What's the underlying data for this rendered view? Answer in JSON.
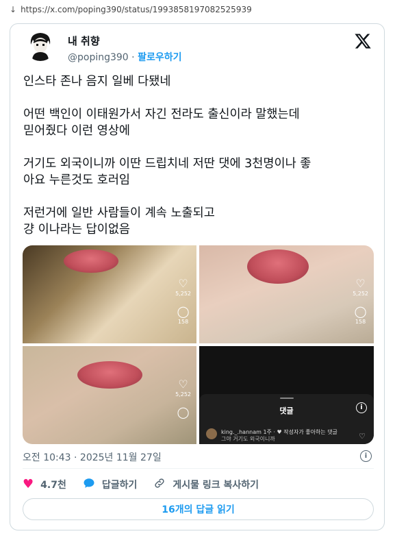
{
  "url": "https://x.com/poping390/status/1993858197082525939",
  "tweet": {
    "display_name": "내 취향",
    "handle": "@poping390",
    "separator": "·",
    "follow_label": "팔로우하기",
    "paragraphs": [
      "인스타 존나 음지 일베 다됐네",
      "어떤 백인이 이태원가서 자긴 전라도 출신이라 말했는데\n믿어줬다 이런 영상에",
      "거기도 외국이니까 이딴 드립치네 저딴 댓에 3천명이나 좋\n아요 누른것도 호러임",
      "저런거에 일반 사람들이 계속 노출되고\n걍 이나라는 답이없음"
    ],
    "timestamp": "오전 10:43 · 2025년 11월 27일",
    "likes": "4.7천",
    "reply_label": "답글하기",
    "copy_link_label": "게시물 링크 복사하기",
    "read_replies_label": "16개의 답글 읽기"
  },
  "media": {
    "tile1": {
      "likes": "5,252",
      "comments": "158"
    },
    "tile2": {
      "likes": "5,252",
      "comments": "158"
    },
    "tile3": {
      "likes": "5,252"
    },
    "tile4": {
      "panel_title": "댓글",
      "comment_user": "king._.hannam 1주 · ♥ 작성자가 좋아하는 댓글",
      "comment_text": "그야 거기도 외국이니까"
    }
  },
  "colors": {
    "accent": "#1d9bf0",
    "like": "#f91880",
    "muted": "#536471"
  },
  "icons": [
    "x-logo-icon",
    "heart-icon",
    "reply-bubble-icon",
    "link-icon",
    "info-icon"
  ]
}
